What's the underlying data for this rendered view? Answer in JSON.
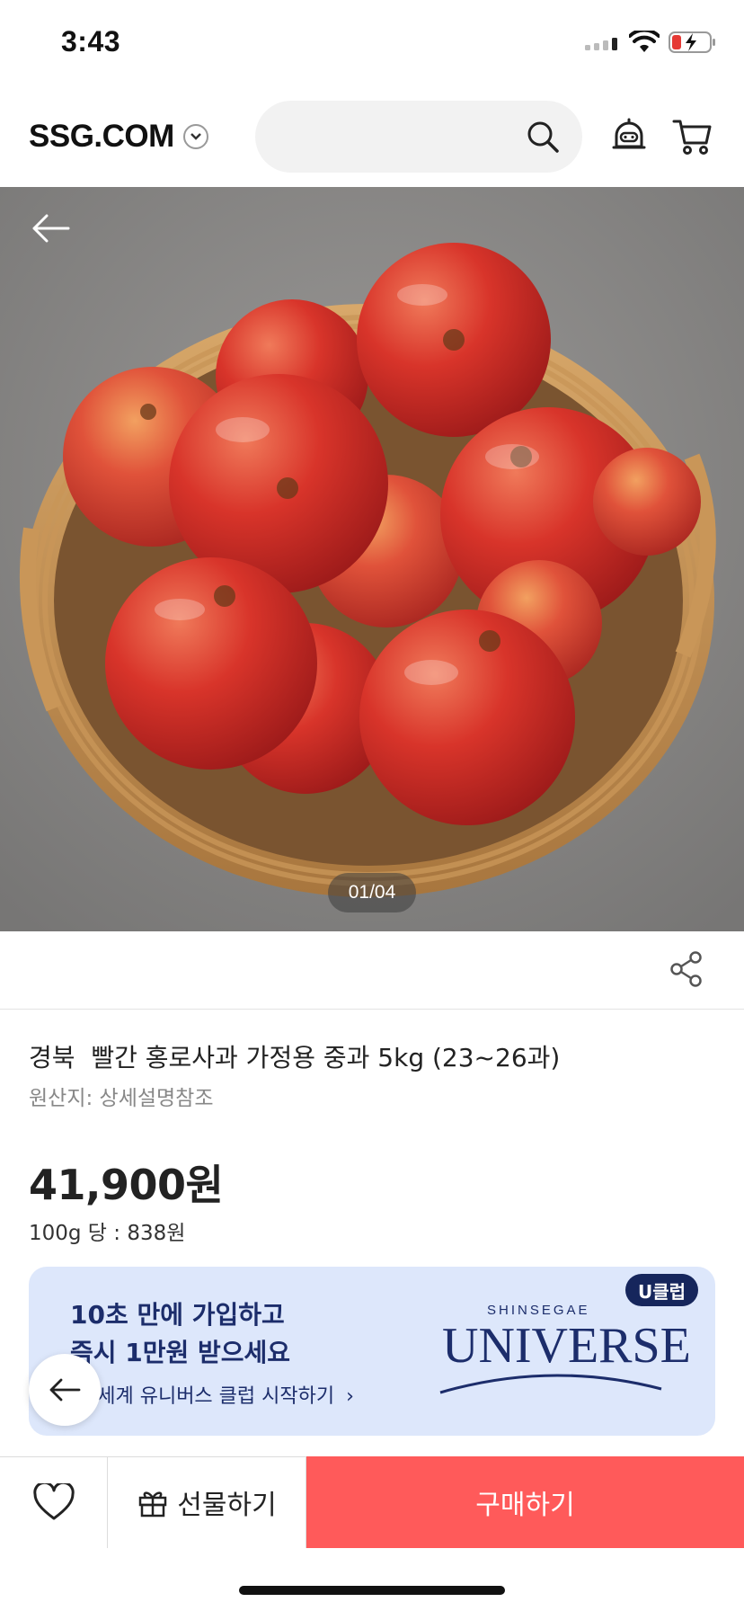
{
  "status_bar": {
    "time": "3:43",
    "icons": [
      "cellular-signal-icon",
      "wifi-icon",
      "battery-charging-icon"
    ]
  },
  "header": {
    "logo": "SSG.COM",
    "search_placeholder": "",
    "icons": [
      "chevron-down-icon",
      "search-icon",
      "bell-icon",
      "cart-icon"
    ]
  },
  "gallery": {
    "counter": "01/04",
    "current": 1,
    "total": 4
  },
  "product": {
    "title": "경북  빨간 홍로사과 가정용 중과 5kg (23~26과)",
    "origin": "원산지: 상세설명참조",
    "price": "41,900원",
    "unit_price": "100g 당 : 838원"
  },
  "banner": {
    "line1": "10초 만에 가입하고",
    "line2": "즉시 1만원 받으세요",
    "cta": "신세계 유니버스 클럽 시작하기",
    "brand_small": "SHINSEGAE",
    "brand_big": "UNIVERSE",
    "badge": "U클럽"
  },
  "bottom_bar": {
    "gift_label": "선물하기",
    "buy_label": "구매하기"
  },
  "colors": {
    "accent": "#ff5a5a",
    "banner_bg": "#dde7fb",
    "banner_text": "#1c2d6b",
    "badge_bg": "#16265c"
  }
}
